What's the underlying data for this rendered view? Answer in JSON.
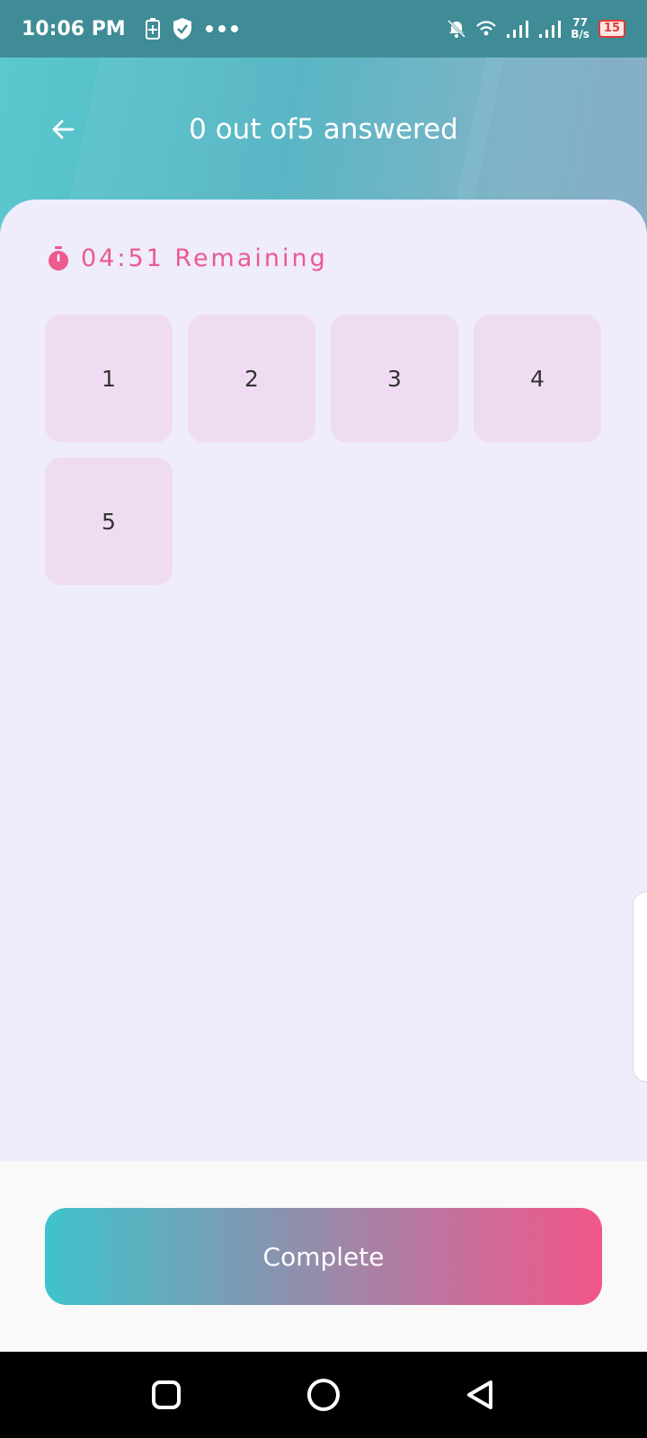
{
  "status_bar": {
    "time": "10:06 PM",
    "left_icons": [
      "battery-saver-icon",
      "shield-check-icon",
      "more-dots-icon"
    ],
    "right_icons": [
      "bell-off-icon",
      "wifi-icon",
      "signal-1-icon",
      "signal-2-icon"
    ],
    "net_speed_value": "77",
    "net_speed_unit": "B/s",
    "battery_level": "15"
  },
  "header": {
    "title": "0 out of5 answered",
    "back_icon": "arrow-left-icon"
  },
  "timer": {
    "icon": "stopwatch-icon",
    "text": "04:51 Remaining",
    "color": "#ec5a8e"
  },
  "questions": [
    "1",
    "2",
    "3",
    "4",
    "5"
  ],
  "footer": {
    "complete_label": "Complete"
  },
  "nav": {
    "recents_icon": "square-icon",
    "home_icon": "circle-icon",
    "back_icon": "triangle-back-icon"
  },
  "colors": {
    "accent_teal": "#3ec3cc",
    "accent_pink": "#f2568a",
    "tile_bg": "#efdcf2",
    "content_bg": "#efecfc"
  }
}
